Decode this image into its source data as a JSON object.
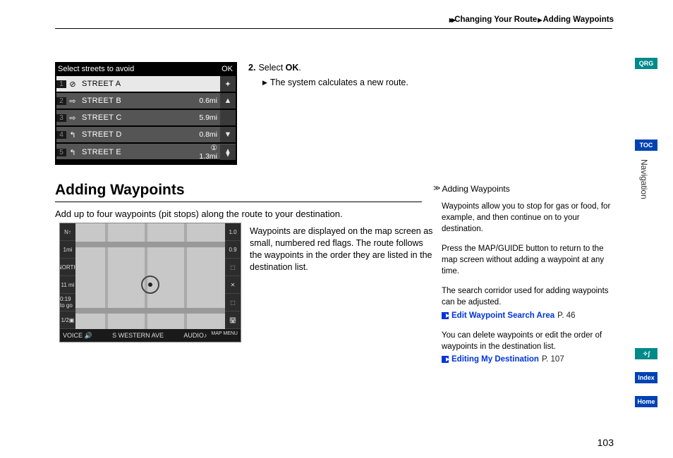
{
  "breadcrumb": {
    "section": "Changing Your Route",
    "page": "Adding Waypoints"
  },
  "screenshot": {
    "title": "Select streets to avoid",
    "ok_label": "OK",
    "rows": [
      {
        "idx": "1",
        "icon": "⊘",
        "name": "STREET A",
        "dist": "",
        "side": "✦",
        "selected": true
      },
      {
        "idx": "2",
        "icon": "⇨",
        "name": "STREET B",
        "dist": "0.6mi",
        "side": "▲",
        "selected": false
      },
      {
        "idx": "3",
        "icon": "⇨",
        "name": "STREET C",
        "dist": "5.9mi",
        "side": "",
        "selected": false
      },
      {
        "idx": "4",
        "icon": "↰",
        "name": "STREET D",
        "dist": "0.8mi",
        "side": "▼",
        "selected": false
      },
      {
        "idx": "5",
        "icon": "↰",
        "name": "STREET E",
        "dist": "① 1.3mi",
        "side": "⧫",
        "selected": false
      }
    ]
  },
  "instruction": {
    "num": "2.",
    "text_a": "Select ",
    "text_b": "OK",
    "text_c": ".",
    "sub": "The system calculates a new route."
  },
  "heading": "Adding Waypoints",
  "intro": "Add up to four waypoints (pit stops) along the route to your destination.",
  "map": {
    "voice_label": "VOICE 🔊",
    "street": "S WESTERN AVE",
    "audio": "AUDIO♪",
    "menu": "MAP MENU",
    "side_left": [
      "N↑",
      "1mi",
      "NORTH",
      "11 mi",
      "0:19 to go",
      "1/2▣"
    ],
    "side_right": [
      "1.0",
      "0.9",
      "⬚",
      "✕",
      "⬚",
      "🛣"
    ]
  },
  "waypoint_text": "Waypoints are displayed on the map screen as small, numbered red flags. The route follows the waypoints in the order they are listed in the destination list.",
  "info": {
    "head": "Adding Waypoints",
    "p1": "Waypoints allow you to stop for gas or food, for example, and then continue on to your destination.",
    "p2": "Press the MAP/GUIDE button to return to the map screen without adding a waypoint at any time.",
    "p3": "The search corridor used for adding waypoints can be adjusted.",
    "xref1": {
      "label": "Edit Waypoint Search Area",
      "page": "P. 46"
    },
    "p4": "You can delete waypoints or edit the order of waypoints in the destination list.",
    "xref2": {
      "label": "Editing My Destination",
      "page": "P. 107"
    }
  },
  "tabs": {
    "qrg": "QRG",
    "toc": "TOC",
    "nav": "Navigation",
    "voice": "✧∫",
    "index": "Index",
    "home": "Home"
  },
  "page_number": "103"
}
